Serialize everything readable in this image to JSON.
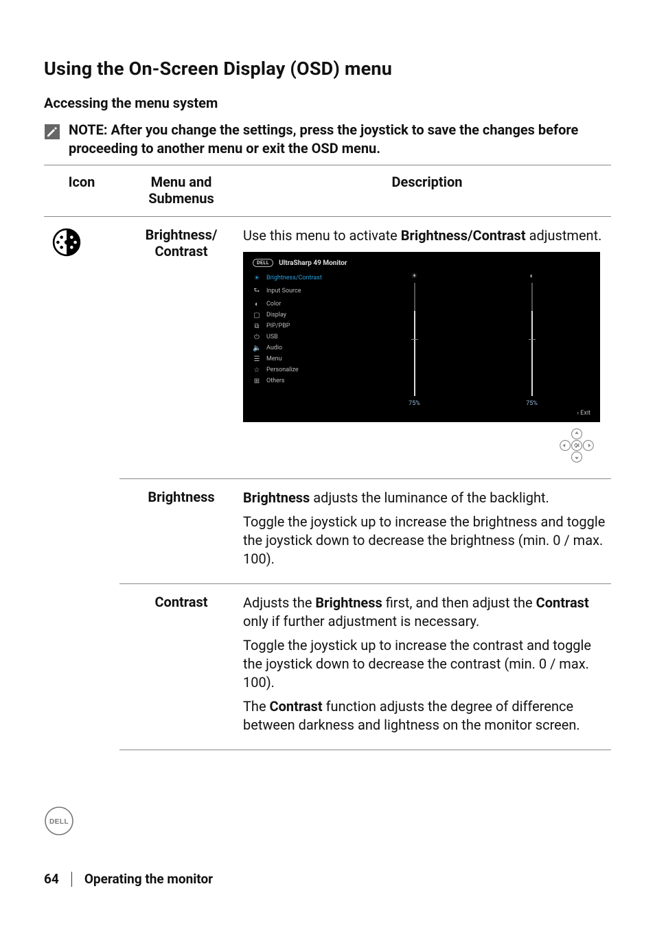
{
  "heading": "Using the On-Screen Display (OSD) menu",
  "subheading": "Accessing the menu system",
  "note_label": "NOTE:",
  "note_body": "After you change the settings, press the joystick to save the changes before proceeding to another menu or exit the OSD menu.",
  "table_headers": {
    "icon": "Icon",
    "menu": "Menu and Submenus",
    "desc": "Description"
  },
  "rows": {
    "bc": {
      "menu": "Brightness/\nContrast",
      "desc_pre": "Use this menu to activate ",
      "desc_bold": "Brightness/Contrast",
      "desc_post": " adjustment."
    },
    "brightness": {
      "menu": "Brightness",
      "p1_bold": "Brightness",
      "p1_rest": " adjusts the luminance of the backlight.",
      "p2": "Toggle the joystick up to increase the brightness and toggle the joystick down to decrease the brightness (min. 0 / max. 100)."
    },
    "contrast": {
      "menu": "Contrast",
      "p1_a": "Adjusts the ",
      "p1_b1": "Brightness",
      "p1_c": " first, and then adjust the ",
      "p1_b2": "Contrast",
      "p1_d": " only if further adjustment is necessary.",
      "p2": "Toggle the joystick up to increase the contrast and toggle the joystick down to decrease the contrast (min. 0 / max. 100).",
      "p3_a": "The ",
      "p3_b": "Contrast",
      "p3_c": " function adjusts the degree of difference between darkness and lightness on the monitor screen."
    }
  },
  "osd": {
    "product": "UltraSharp 49 Monitor",
    "brand": "DELL",
    "items": [
      {
        "label": "Brightness/Contrast",
        "glyph": "☀",
        "active": true
      },
      {
        "label": "Input Source",
        "glyph": "⮑",
        "active": false
      },
      {
        "label": "Color",
        "glyph": "◐",
        "active": false
      },
      {
        "label": "Display",
        "glyph": "▢",
        "active": false
      },
      {
        "label": "PIP/PBP",
        "glyph": "⧉",
        "active": false
      },
      {
        "label": "USB",
        "glyph": "⏻",
        "active": false
      },
      {
        "label": "Audio",
        "glyph": "🔈",
        "active": false
      },
      {
        "label": "Menu",
        "glyph": "☰",
        "active": false
      },
      {
        "label": "Personalize",
        "glyph": "☆",
        "active": false
      },
      {
        "label": "Others",
        "glyph": "⊞",
        "active": false
      }
    ],
    "sliders": [
      {
        "icon": "☀",
        "value": "75%",
        "fill": 75
      },
      {
        "icon": "◐",
        "value": "75%",
        "fill": 75
      }
    ],
    "exit": "‹  Exit"
  },
  "footer": {
    "page": "64",
    "section": "Operating the monitor",
    "brand": "DELL"
  }
}
